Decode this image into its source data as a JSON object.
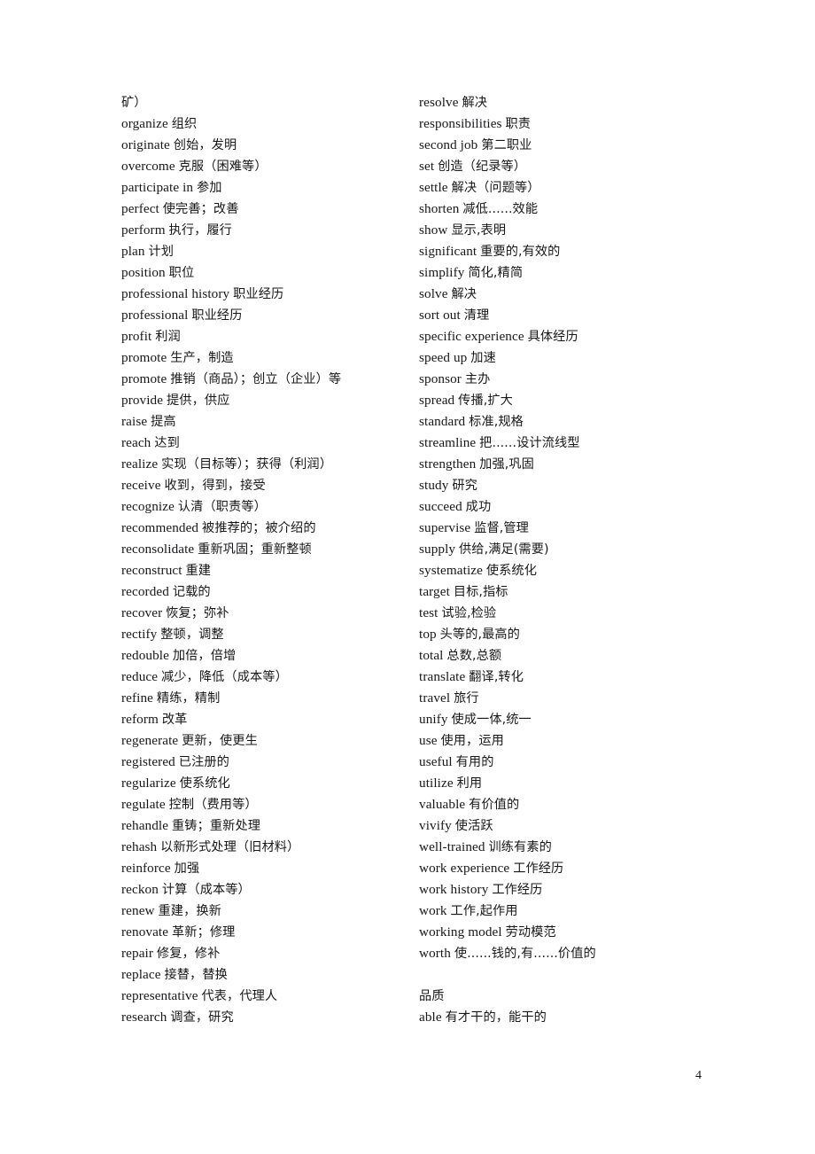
{
  "page": {
    "number": "4"
  },
  "columns": {
    "left": {
      "entries": [
        {
          "term": "",
          "gloss": "矿）"
        },
        {
          "term": "organize",
          "gloss": "组织"
        },
        {
          "term": "originate",
          "gloss": "创始，发明"
        },
        {
          "term": "overcome",
          "gloss": "克服（困难等）"
        },
        {
          "term": "participate in",
          "gloss": "参加"
        },
        {
          "term": "perfect",
          "gloss": "使完善；改善"
        },
        {
          "term": "perform",
          "gloss": "执行，履行"
        },
        {
          "term": "plan",
          "gloss": "计划"
        },
        {
          "term": "position",
          "gloss": "职位"
        },
        {
          "term": "professional history",
          "gloss": "职业经历"
        },
        {
          "term": "professional",
          "gloss": "职业经历"
        },
        {
          "term": "profit",
          "gloss": "利润"
        },
        {
          "term": "promote",
          "gloss": "生产，制造"
        },
        {
          "term": "promote",
          "gloss": "推销（商品）；创立（企业）等"
        },
        {
          "term": "provide",
          "gloss": "提供，供应"
        },
        {
          "term": "raise",
          "gloss": "提高"
        },
        {
          "term": "reach",
          "gloss": "达到"
        },
        {
          "term": "realize",
          "gloss": "实现（目标等）；获得（利润）"
        },
        {
          "term": "receive",
          "gloss": "收到，得到，接受"
        },
        {
          "term": "recognize",
          "gloss": "认清（职责等）"
        },
        {
          "term": "recommended",
          "gloss": "被推荐的；被介绍的"
        },
        {
          "term": "reconsolidate",
          "gloss": "重新巩固；重新整顿"
        },
        {
          "term": "reconstruct",
          "gloss": "重建"
        },
        {
          "term": "recorded",
          "gloss": "记载的"
        },
        {
          "term": "recover",
          "gloss": "恢复；弥补"
        },
        {
          "term": "rectify",
          "gloss": "整顿，调整"
        },
        {
          "term": "redouble",
          "gloss": "加倍，倍增"
        },
        {
          "term": "reduce",
          "gloss": "减少，降低（成本等）"
        },
        {
          "term": "refine",
          "gloss": "精练，精制"
        },
        {
          "term": "reform",
          "gloss": "改革"
        },
        {
          "term": "regenerate",
          "gloss": "更新，使更生"
        },
        {
          "term": "registered",
          "gloss": "已注册的"
        },
        {
          "term": "regularize",
          "gloss": "使系统化"
        },
        {
          "term": "regulate",
          "gloss": "控制（费用等）"
        },
        {
          "term": "rehandle",
          "gloss": "重铸；重新处理"
        },
        {
          "term": "rehash",
          "gloss": "以新形式处理（旧材料）"
        },
        {
          "term": "reinforce",
          "gloss": "加强"
        },
        {
          "term": "reckon",
          "gloss": "计算（成本等）"
        },
        {
          "term": "renew",
          "gloss": "重建，换新"
        },
        {
          "term": "renovate",
          "gloss": "革新；修理"
        },
        {
          "term": "repair",
          "gloss": "修复，修补"
        },
        {
          "term": "replace",
          "gloss": "接替，替换"
        },
        {
          "term": "representative",
          "gloss": "代表，代理人"
        },
        {
          "term": "research",
          "gloss": "调查，研究"
        }
      ]
    },
    "right": {
      "entries": [
        {
          "term": "resolve",
          "gloss": "解决"
        },
        {
          "term": "responsibilities",
          "gloss": "职责"
        },
        {
          "term": "second job",
          "gloss": "第二职业"
        },
        {
          "term": "set",
          "gloss": "创造（纪录等）"
        },
        {
          "term": "settle",
          "gloss": "解决（问题等）"
        },
        {
          "term": "shorten",
          "gloss": "减低......效能"
        },
        {
          "term": "show",
          "gloss": "显示,表明"
        },
        {
          "term": "significant",
          "gloss": "重要的,有效的"
        },
        {
          "term": "simplify",
          "gloss": "简化,精简"
        },
        {
          "term": "solve",
          "gloss": "解决"
        },
        {
          "term": "sort out",
          "gloss": "清理"
        },
        {
          "term": "specific experience",
          "gloss": "具体经历"
        },
        {
          "term": "speed up",
          "gloss": "加速"
        },
        {
          "term": "sponsor",
          "gloss": "主办"
        },
        {
          "term": "spread",
          "gloss": "传播,扩大"
        },
        {
          "term": "standard",
          "gloss": "标准,规格"
        },
        {
          "term": "streamline",
          "gloss": "把......设计流线型"
        },
        {
          "term": "strengthen",
          "gloss": "加强,巩固"
        },
        {
          "term": "study",
          "gloss": "研究"
        },
        {
          "term": "succeed",
          "gloss": "成功"
        },
        {
          "term": "supervise",
          "gloss": "监督,管理"
        },
        {
          "term": "supply",
          "gloss": "供给,满足(需要)"
        },
        {
          "term": "systematize",
          "gloss": "使系统化"
        },
        {
          "term": "target",
          "gloss": "目标,指标"
        },
        {
          "term": "test",
          "gloss": "试验,检验"
        },
        {
          "term": "top",
          "gloss": "头等的,最高的"
        },
        {
          "term": "total",
          "gloss": "总数,总额"
        },
        {
          "term": "translate",
          "gloss": "翻译,转化"
        },
        {
          "term": "travel",
          "gloss": "旅行"
        },
        {
          "term": "unify",
          "gloss": "使成一体,统一"
        },
        {
          "term": "use",
          "gloss": "使用，运用"
        },
        {
          "term": "useful",
          "gloss": "有用的"
        },
        {
          "term": "utilize",
          "gloss": "利用"
        },
        {
          "term": "valuable",
          "gloss": "有价值的"
        },
        {
          "term": "vivify",
          "gloss": "使活跃"
        },
        {
          "term": "well-trained",
          "gloss": "训练有素的"
        },
        {
          "term": "work experience",
          "gloss": "工作经历"
        },
        {
          "term": "work history",
          "gloss": "工作经历"
        },
        {
          "term": "work",
          "gloss": "工作,起作用"
        },
        {
          "term": "working model",
          "gloss": "劳动模范"
        },
        {
          "term": "worth",
          "gloss": "使......钱的,有......价值的"
        }
      ],
      "section_heading": "品质",
      "entries_after_heading": [
        {
          "term": "able",
          "gloss": "有才干的，能干的"
        }
      ]
    }
  }
}
